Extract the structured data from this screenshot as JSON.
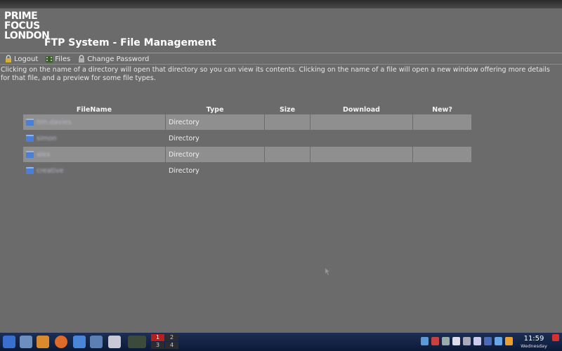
{
  "logo": {
    "lines": [
      "PRIME",
      "FOCUS",
      "LONDON"
    ]
  },
  "app_title": "FTP System - File Management",
  "nav": {
    "logout": "Logout",
    "files": "Files",
    "change_password": "Change Password"
  },
  "intro_text": "Clicking on the name of a directory will open that directory so you can view its contents. Clicking on the name of a file will open a new window offering more details for that file, and a preview for some file types.",
  "table": {
    "headers": [
      "FileName",
      "Type",
      "Size",
      "Download",
      "New?"
    ],
    "rows": [
      {
        "name": "tim.davies",
        "type": "Directory",
        "size": "",
        "download": "",
        "new": ""
      },
      {
        "name": "simon",
        "type": "Directory",
        "size": "",
        "download": "",
        "new": ""
      },
      {
        "name": "alex",
        "type": "Directory",
        "size": "",
        "download": "",
        "new": ""
      },
      {
        "name": "creative",
        "type": "Directory",
        "size": "",
        "download": "",
        "new": ""
      }
    ]
  },
  "taskbar": {
    "pager": [
      "1",
      "2",
      "3",
      "4"
    ],
    "clock": {
      "time": "11:59",
      "day": "Wednesday"
    }
  },
  "colors": {
    "background": "#6b6b6b",
    "row_alt": "#8f8f8f",
    "taskbar": "#0c1a38",
    "folder": "#4b7fd6"
  }
}
